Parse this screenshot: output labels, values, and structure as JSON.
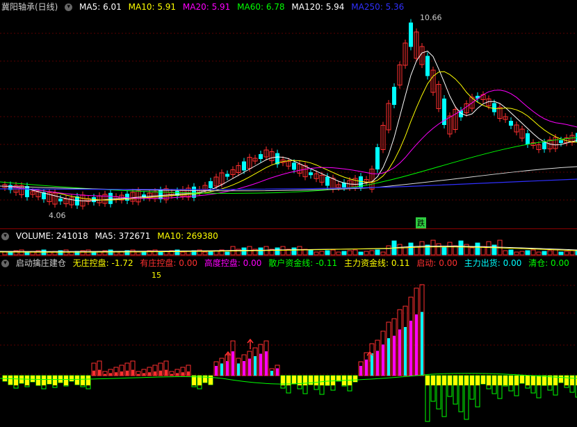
{
  "price_pane": {
    "title": "冀阳轴承(日线)",
    "ma": [
      {
        "label": "MA5: 6.01",
        "color": "#ffffff"
      },
      {
        "label": "MA10: 5.91",
        "color": "#ffff00"
      },
      {
        "label": "MA20: 5.91",
        "color": "#ff00ff"
      },
      {
        "label": "MA60: 6.78",
        "color": "#00ff00"
      },
      {
        "label": "MA120: 5.94",
        "color": "#ffffff"
      },
      {
        "label": "MA250: 5.36",
        "color": "#3030ff"
      }
    ],
    "high_label": "10.66",
    "low_label": "4.06",
    "signal_label": "跌"
  },
  "volume_pane": {
    "items": [
      {
        "label": "VOLUME: 241018",
        "color": "#ffffff"
      },
      {
        "label": "MA5: 372671",
        "color": "#ffffff"
      },
      {
        "label": "MA10: 269380",
        "color": "#ffff00"
      }
    ]
  },
  "indicator_pane": {
    "title": "启动擒庄建仓",
    "items": [
      {
        "label": "无庄控盘: -1.72",
        "color": "#ffff00"
      },
      {
        "label": "有庄控盘: 0.00",
        "color": "#ff3030"
      },
      {
        "label": "高度控盘: 0.00",
        "color": "#ff00ff"
      },
      {
        "label": "散户资金线: -0.11",
        "color": "#00ff00"
      },
      {
        "label": "主力资金线: 0.11",
        "color": "#ffff00"
      },
      {
        "label": "启动: 0.00",
        "color": "#ff3030"
      },
      {
        "label": "主力出货: 0.00",
        "color": "#00ffff"
      },
      {
        "label": "清仓: 0.00",
        "color": "#00ff00"
      }
    ],
    "value_label": "15"
  }
}
